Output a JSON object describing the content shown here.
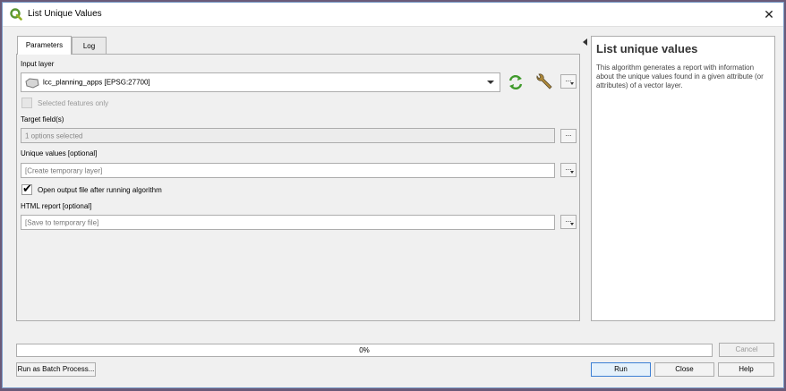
{
  "window": {
    "title": "List Unique Values",
    "close_label": "✕"
  },
  "tabs": [
    {
      "label": "Parameters",
      "active": true
    },
    {
      "label": "Log",
      "active": false
    }
  ],
  "form": {
    "input_layer_label": "Input layer",
    "input_layer_value": "lcc_planning_apps [EPSG:27700]",
    "selected_only_label": "Selected features only",
    "selected_only_checked": false,
    "target_fields_label": "Target field(s)",
    "target_fields_value": "1 options selected",
    "unique_values_label": "Unique values [optional]",
    "unique_values_placeholder": "[Create temporary layer]",
    "open_output_label": "Open output file after running algorithm",
    "open_output_checked": true,
    "html_report_label": "HTML report [optional]",
    "html_report_placeholder": "[Save to temporary file]",
    "ellipsis": "..."
  },
  "help": {
    "title": "List unique values",
    "body": "This algorithm generates a report with information about the unique values found in a given attribute (or attributes) of a vector layer."
  },
  "progress": {
    "value": 0,
    "label": "0%"
  },
  "buttons": {
    "cancel": "Cancel",
    "batch": "Run as Batch Process...",
    "run": "Run",
    "close": "Close",
    "help": "Help"
  }
}
